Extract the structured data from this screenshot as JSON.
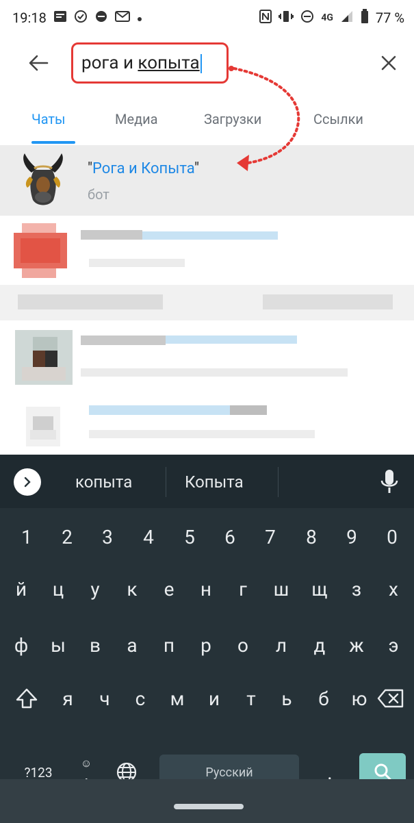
{
  "status_bar": {
    "time": "19:18",
    "left_icons": [
      "notification-icon",
      "check-circle-icon",
      "record-icon",
      "gmail-icon",
      "dot-icon"
    ],
    "right_icons": [
      "nfc-icon",
      "vibrate-icon",
      "do-not-disturb-icon",
      "4g-icon",
      "signal-icon",
      "battery-icon"
    ],
    "network_label": "4G",
    "battery": "77 %"
  },
  "search": {
    "text_plain": "рога и ",
    "text_underlined": "копыта",
    "value": "рога и копыта"
  },
  "tabs": [
    {
      "label": "Чаты",
      "active": true
    },
    {
      "label": "Медиа",
      "active": false
    },
    {
      "label": "Загрузки",
      "active": false
    },
    {
      "label": "Ссылки",
      "active": false
    }
  ],
  "result": {
    "title": "Рога и Копыта",
    "quote_open": "\"",
    "quote_close": "\"",
    "subtitle": "бот"
  },
  "keyboard": {
    "suggestions": [
      "копыта",
      "Копыта"
    ],
    "row_numbers": [
      "1",
      "2",
      "3",
      "4",
      "5",
      "6",
      "7",
      "8",
      "9",
      "0"
    ],
    "row1": [
      "й",
      "ц",
      "у",
      "к",
      "е",
      "н",
      "г",
      "ш",
      "щ",
      "з",
      "х"
    ],
    "row2": [
      "ф",
      "ы",
      "в",
      "а",
      "п",
      "р",
      "о",
      "л",
      "д",
      "ж",
      "э"
    ],
    "row3": [
      "я",
      "ч",
      "с",
      "м",
      "и",
      "т",
      "ь",
      "б",
      "ю"
    ],
    "symbols_key": "?123",
    "emoji_comma_top": "☺",
    "emoji_comma_bottom": ",",
    "space_label": "Русский",
    "period_key": "."
  },
  "colors": {
    "accent": "#2196f3",
    "highlight_border": "#e53935",
    "annotation_red": "#e53935",
    "keyboard_bg": "#263238",
    "search_key": "#7fcac3"
  }
}
